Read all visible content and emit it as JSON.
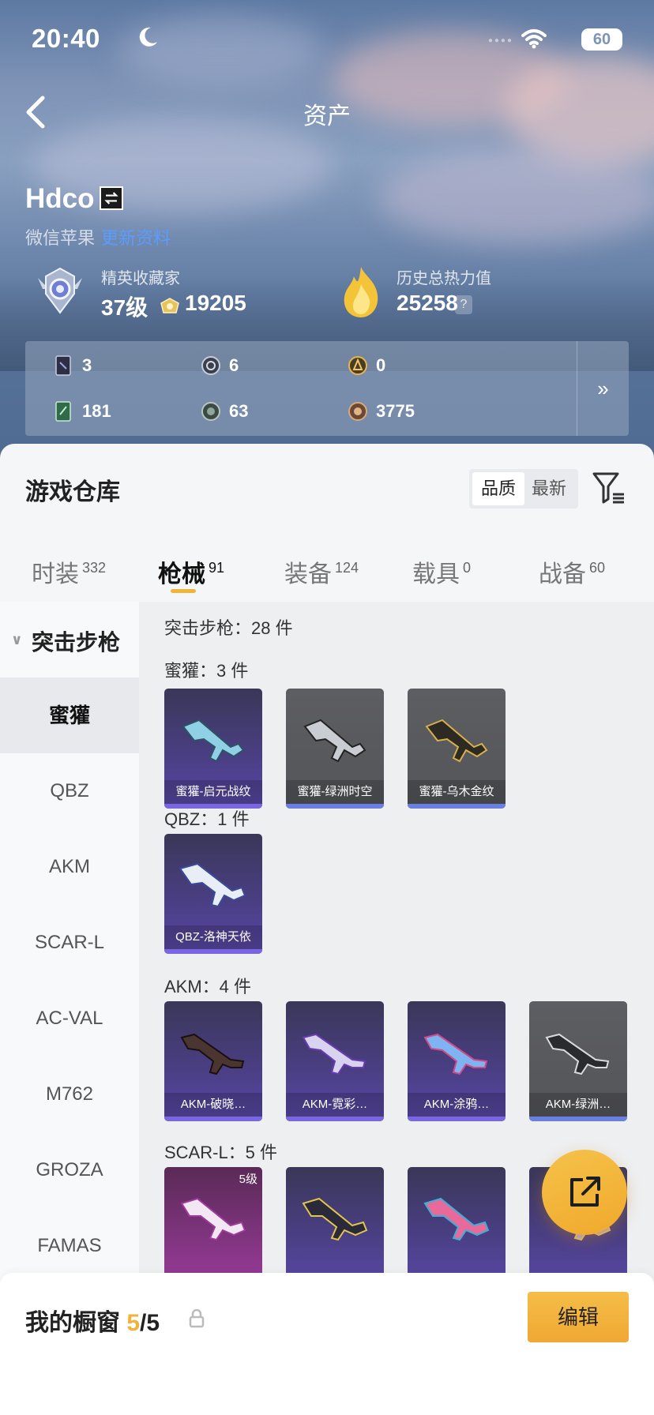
{
  "status_bar": {
    "time": "20:40",
    "battery": "60"
  },
  "nav": {
    "title": "资产"
  },
  "profile": {
    "username": "Hdco",
    "platform": "微信苹果",
    "platform_link": "更新资料",
    "rank_title": "精英收藏家",
    "level": "37级",
    "coins": "19205",
    "heat_title": "历史总热力值",
    "heat_value": "25258"
  },
  "stats": [
    {
      "icon": "card-icon",
      "value": "3"
    },
    {
      "icon": "silver-emblem-icon",
      "value": "6"
    },
    {
      "icon": "gold-emblem-icon",
      "value": "0"
    },
    {
      "icon": "green-card-icon",
      "value": "181"
    },
    {
      "icon": "dark-orb-icon",
      "value": "63"
    },
    {
      "icon": "bronze-orb-icon",
      "value": "3775"
    }
  ],
  "warehouse": {
    "title": "游戏仓库",
    "sort": [
      "品质",
      "最新"
    ],
    "tabs": [
      {
        "label": "时装",
        "count": "332"
      },
      {
        "label": "枪械",
        "count": "91"
      },
      {
        "label": "装备",
        "count": "124"
      },
      {
        "label": "载具",
        "count": "0"
      },
      {
        "label": "战备",
        "count": "60"
      }
    ],
    "category": "突击步枪",
    "sidebar": [
      "蜜獾",
      "QBZ",
      "AKM",
      "SCAR-L",
      "AC-VAL",
      "M762",
      "GROZA",
      "FAMAS"
    ],
    "summary": "突击步枪：28 件",
    "groups": [
      {
        "label": "蜜獾：3 件",
        "items": [
          "蜜獾-启元战纹",
          "蜜獾-绿洲时空",
          "蜜獾-乌木金纹"
        ]
      },
      {
        "label": "QBZ：1 件",
        "items": [
          "QBZ-洛神天依"
        ]
      },
      {
        "label": "AKM：4 件",
        "items": [
          "AKM-破晓…",
          "AKM-霓彩…",
          "AKM-涂鸦…",
          "AKM-绿洲…"
        ]
      },
      {
        "label": "SCAR-L：5 件",
        "items": [
          "",
          "",
          "",
          ""
        ],
        "badge": "5级"
      }
    ]
  },
  "showcase": {
    "label": "我的橱窗",
    "current": "5",
    "total": "/5",
    "edit": "编辑"
  }
}
